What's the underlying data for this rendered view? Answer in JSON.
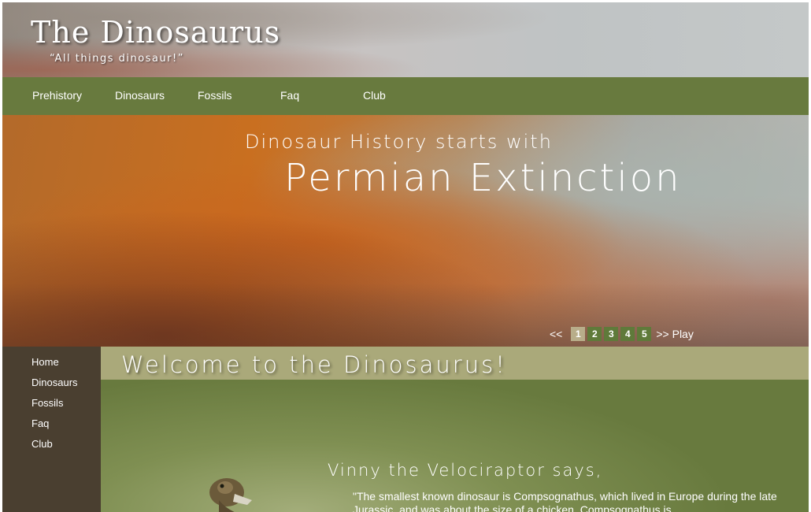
{
  "header": {
    "title": "The Dinosaurus",
    "tagline": "“All things dinosaur!”"
  },
  "topnav": {
    "items": [
      "Prehistory",
      "Dinosaurs",
      "Fossils",
      "Faq",
      "Club"
    ]
  },
  "hero": {
    "subtitle": "Dinosaur History starts with",
    "headline": "Permian Extinction",
    "pager": {
      "prev": "<<",
      "pages": [
        "1",
        "2",
        "3",
        "4",
        "5"
      ],
      "active_page": "1",
      "next": ">> Play"
    }
  },
  "sidenav": {
    "items": [
      "Home",
      "Dinosaurs",
      "Fossils",
      "Faq",
      "Club"
    ]
  },
  "main": {
    "welcome_title": "Welcome to the Dinosaurus!",
    "says_heading": "Vinny the Velociraptor says,",
    "quote": "\"The smallest known dinosaur is Compsognathus, which lived in Europe during the late Jurassic, and was about the size of a chicken. Compsognathus is"
  },
  "colors": {
    "nav_green": "#687a3e",
    "welcome_bar": "#aaa97a",
    "sidenav_brown": "#4a3f30",
    "pager_green": "#5f7a3a",
    "pager_active": "#b8ad8a"
  }
}
